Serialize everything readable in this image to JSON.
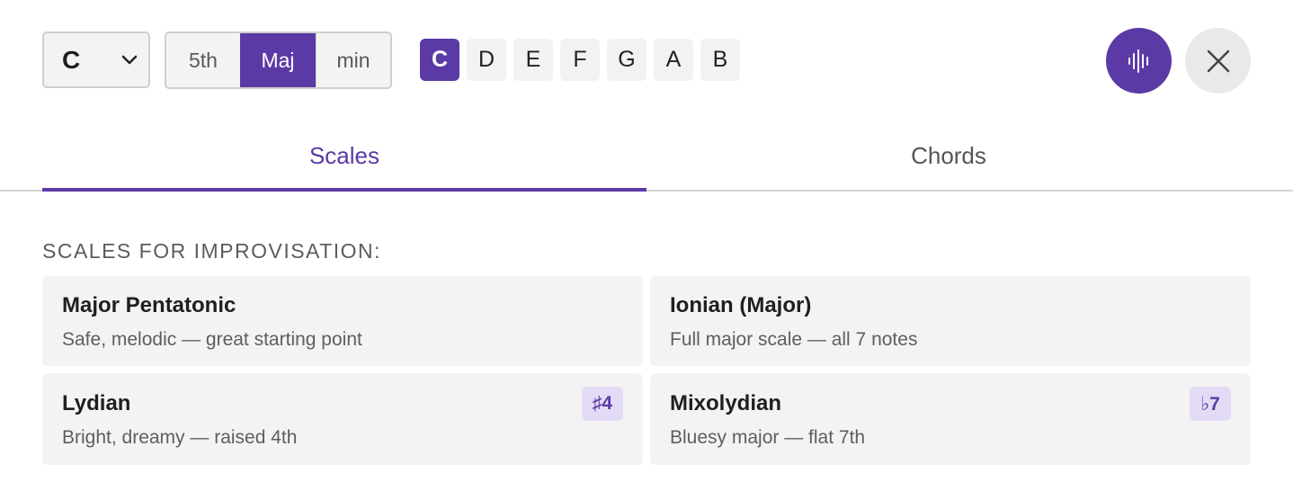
{
  "key_select": {
    "value": "C",
    "icon": "chevron-down-icon"
  },
  "quality": {
    "options": [
      {
        "label": "5th"
      },
      {
        "label": "Maj"
      },
      {
        "label": "min"
      }
    ],
    "selected": "Maj"
  },
  "notes": {
    "items": [
      "C",
      "D",
      "E",
      "F",
      "G",
      "A",
      "B"
    ],
    "selected": "C"
  },
  "actions": {
    "audio_icon": "sound-wave-icon",
    "close_icon": "close-icon"
  },
  "tabs": [
    {
      "label": "Scales"
    },
    {
      "label": "Chords"
    }
  ],
  "active_tab": "Scales",
  "section": {
    "title": "SCALES FOR IMPROVISATION:",
    "cards": [
      {
        "name": "Major Pentatonic",
        "desc": "Safe, melodic — great starting point",
        "badge": ""
      },
      {
        "name": "Ionian (Major)",
        "desc": "Full major scale — all 7 notes",
        "badge": ""
      },
      {
        "name": "Lydian",
        "desc": "Bright, dreamy — raised 4th",
        "badge": "♯4"
      },
      {
        "name": "Mixolydian",
        "desc": "Bluesy major — flat 7th",
        "badge": "♭7"
      }
    ]
  },
  "colors": {
    "accent": "#5b3aa6",
    "badge_bg": "#e3daf5",
    "card_bg": "#f3f3f3"
  }
}
